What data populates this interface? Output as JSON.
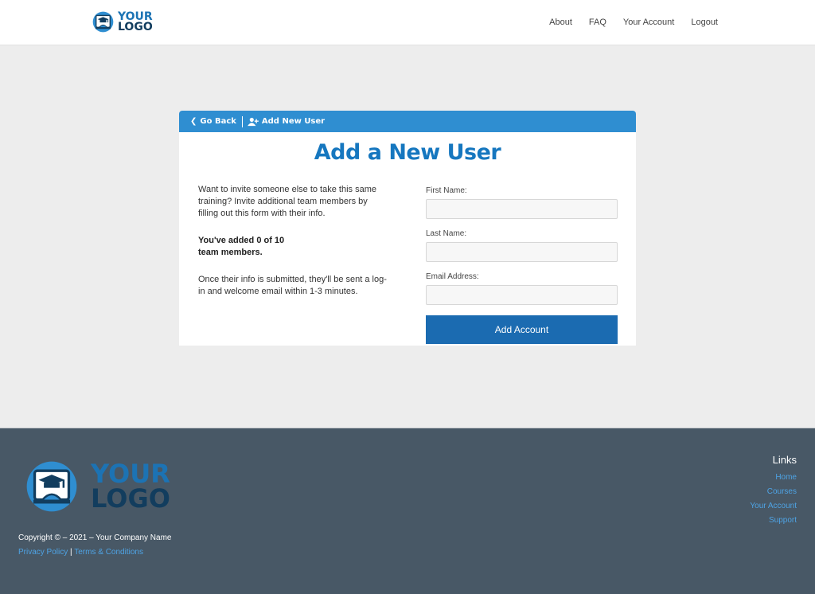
{
  "header": {
    "logo": {
      "line1": "YOUR",
      "line2": "LOGO"
    },
    "nav": [
      {
        "label": "About"
      },
      {
        "label": "FAQ"
      },
      {
        "label": "Your Account"
      },
      {
        "label": "Logout"
      }
    ]
  },
  "card": {
    "bar": {
      "back_label": "Go Back",
      "current_label": "Add New User"
    },
    "title": "Add a New User",
    "intro": "Want to invite someone else to take this same training? Invite additional team members by filling out this form with their info.",
    "added_line1": "You've added 0 of 10",
    "added_line2": "team members.",
    "note": "Once their info is submitted, they'll be sent a log-in and welcome email within 1-3 minutes.",
    "form": {
      "first_name_label": "First Name:",
      "first_name_value": "",
      "last_name_label": "Last Name:",
      "last_name_value": "",
      "email_label": "Email Address:",
      "email_value": "",
      "submit_label": "Add Account"
    }
  },
  "footer": {
    "logo": {
      "line1": "YOUR",
      "line2": "LOGO"
    },
    "copyright": "Copyright © – 2021 – Your Company Name",
    "privacy": "Privacy Policy",
    "divider": "|",
    "terms": "Terms & Conditions",
    "links_heading": "Links",
    "links": [
      {
        "label": "Home"
      },
      {
        "label": "Courses"
      },
      {
        "label": "Your Account"
      },
      {
        "label": "Support"
      }
    ]
  },
  "colors": {
    "accent": "#2f8ed1",
    "title": "#1677bf",
    "button": "#1b6bb1",
    "footer_bg": "#485866",
    "footer_link": "#4ea3e4"
  }
}
